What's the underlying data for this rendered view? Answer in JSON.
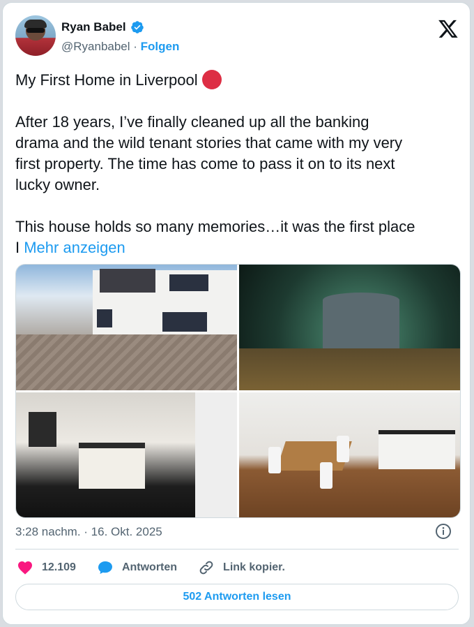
{
  "author": {
    "name": "Ryan Babel",
    "handle": "@Ryanbabel",
    "separator": " · ",
    "follow_label": "Folgen"
  },
  "post": {
    "title": "My First Home in Liverpool",
    "body": "After 18 years, I’ve finally cleaned up all the banking\ndrama and the wild tenant stories that came with my very\nfirst property. The time has come to pass it on to its next\nlucky owner.\n\nThis house holds so many memories…it was the first place\nI ",
    "more_label": "Mehr anzeigen",
    "timestamp": "3:28 nachm. · 16. Okt. 2025"
  },
  "icons": {
    "verified": "verified-badge-icon",
    "close": "x-logo-icon",
    "info": "info-icon",
    "like": "heart-icon",
    "reply": "speech-bubble-icon",
    "link": "link-icon",
    "emoji": "red-circle-emoji"
  },
  "actions": {
    "likes": "12.109",
    "reply_label": "Antworten",
    "link_label": "Link kopier."
  },
  "read_replies_label": "502 Antworten lesen",
  "colors": {
    "accent": "#1d9bf0",
    "like": "#f91880",
    "emoji_red": "#dd2e44"
  }
}
